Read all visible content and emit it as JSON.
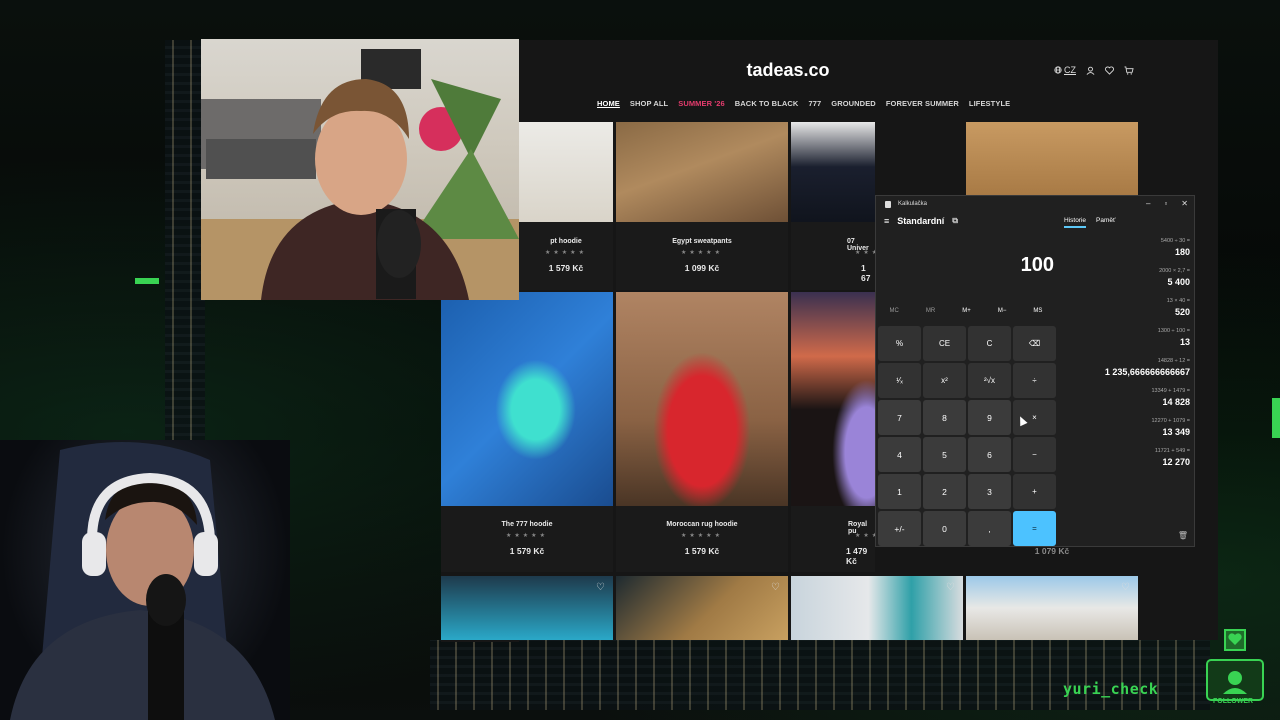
{
  "site": {
    "logo": "tadeas.co",
    "lang": "CZ",
    "nav": [
      "HOME",
      "SHOP ALL",
      "SUMMER '26",
      "BACK TO BLACK",
      "777",
      "GROUNDED",
      "FOREVER SUMMER",
      "LIFESTYLE"
    ],
    "row1": [
      {
        "name": "pt hoodie",
        "stars": "★★★★★",
        "price": "1 579 Kč"
      },
      {
        "name": "Egypt sweatpants",
        "stars": "★★★★★",
        "price": "1 099 Kč"
      },
      {
        "name": "07 Univer",
        "stars": "★★★★★",
        "price": "1 67"
      }
    ],
    "row2": [
      {
        "name": "The 777 hoodie",
        "stars": "★★★★★",
        "price": "1 579 Kč"
      },
      {
        "name": "Moroccan rug hoodie",
        "stars": "★★★★★",
        "price": "1 579 Kč"
      },
      {
        "name": "Royal pu",
        "stars": "★★★★★",
        "price": "1 479 Kč"
      },
      {
        "name": "",
        "stars": "",
        "price": "1 079 Kč"
      }
    ]
  },
  "calculator": {
    "app_title": "Kalkulačka",
    "mode": "Standardní",
    "tabs": [
      "Historie",
      "Paměť"
    ],
    "display": "100",
    "memory": [
      "MC",
      "MR",
      "M+",
      "M−",
      "MS"
    ],
    "keys": [
      "%",
      "CE",
      "C",
      "⌫",
      "¹⁄ₓ",
      "x²",
      "²√x",
      "÷",
      "7",
      "8",
      "9",
      "×",
      "4",
      "5",
      "6",
      "−",
      "1",
      "2",
      "3",
      "+",
      "+/-",
      "0",
      ",",
      "="
    ],
    "history": [
      {
        "expr": "5400 ÷ 30 =",
        "result": "180"
      },
      {
        "expr": "2000 × 2,7 =",
        "result": "5 400"
      },
      {
        "expr": "13 × 40 =",
        "result": "520"
      },
      {
        "expr": "1300 ÷ 100 =",
        "result": "13"
      },
      {
        "expr": "14828 ÷ 12 =",
        "result": "1 235,666666666667"
      },
      {
        "expr": "13349 + 1479 =",
        "result": "14 828"
      },
      {
        "expr": "12270 + 1079 =",
        "result": "13 349"
      },
      {
        "expr": "11721 + 549 =",
        "result": "12 270"
      }
    ]
  },
  "overlay": {
    "username": "yuri_check",
    "follower_label": "FOLLOWER"
  },
  "colors": {
    "accent_pink": "#e43c6d",
    "calc_equals": "#4cc2ff",
    "stream_green": "#39d353"
  }
}
